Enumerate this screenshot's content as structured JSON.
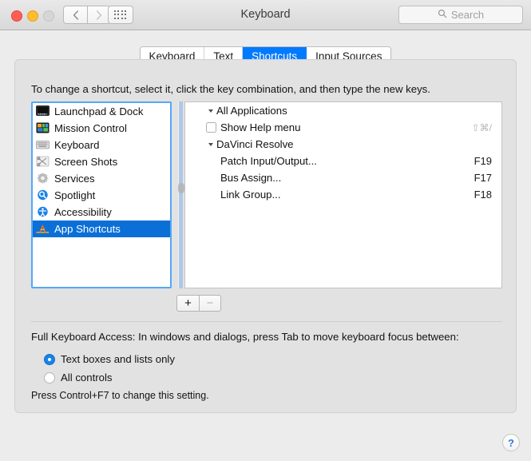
{
  "window": {
    "title": "Keyboard",
    "traffic_lights": [
      {
        "name": "close",
        "color": "#ff5f57"
      },
      {
        "name": "minimize",
        "color": "#ffbd2e"
      },
      {
        "name": "zoom",
        "color": "#d6d6d6"
      }
    ],
    "nav": {
      "back_icon": "chevron-left-icon",
      "forward_icon": "chevron-right-icon",
      "grid_icon": "show-all-grid-icon"
    },
    "search": {
      "placeholder": "Search",
      "value": "",
      "icon": "search-icon"
    }
  },
  "tabs": [
    {
      "label": "Keyboard",
      "active": false
    },
    {
      "label": "Text",
      "active": false
    },
    {
      "label": "Shortcuts",
      "active": true
    },
    {
      "label": "Input Sources",
      "active": false
    }
  ],
  "instructions": "To change a shortcut, select it, click the key combination, and then type the new keys.",
  "categories": [
    {
      "label": "Launchpad & Dock",
      "icon": "launchpad-dock-icon",
      "selected": false
    },
    {
      "label": "Mission Control",
      "icon": "mission-control-icon",
      "selected": false
    },
    {
      "label": "Keyboard",
      "icon": "keyboard-icon",
      "selected": false
    },
    {
      "label": "Screen Shots",
      "icon": "screenshots-icon",
      "selected": false
    },
    {
      "label": "Services",
      "icon": "services-gear-icon",
      "selected": false
    },
    {
      "label": "Spotlight",
      "icon": "spotlight-icon",
      "selected": false
    },
    {
      "label": "Accessibility",
      "icon": "accessibility-icon",
      "selected": false
    },
    {
      "label": "App Shortcuts",
      "icon": "app-shortcuts-icon",
      "selected": true
    }
  ],
  "shortcut_groups": [
    {
      "name": "All Applications",
      "expanded": true,
      "items": [
        {
          "label": "Show Help menu",
          "key": "⇧⌘/",
          "has_checkbox": true,
          "checked": false,
          "key_dim": true
        }
      ]
    },
    {
      "name": "DaVinci Resolve",
      "expanded": true,
      "items": [
        {
          "label": "Patch Input/Output...",
          "key": "F19",
          "has_checkbox": false,
          "checked": false,
          "key_dim": false
        },
        {
          "label": "Bus Assign...",
          "key": "F17",
          "has_checkbox": false,
          "checked": false,
          "key_dim": false
        },
        {
          "label": "Link Group...",
          "key": "F18",
          "has_checkbox": false,
          "checked": false,
          "key_dim": false
        }
      ]
    }
  ],
  "list_buttons": {
    "add_label": "+",
    "remove_label": "−"
  },
  "full_keyboard_access": {
    "label": "Full Keyboard Access: In windows and dialogs, press Tab to move keyboard focus between:",
    "options": [
      {
        "label": "Text boxes and lists only",
        "selected": true
      },
      {
        "label": "All controls",
        "selected": false
      }
    ],
    "hint": "Press Control+F7 to change this setting."
  },
  "help_button": {
    "label": "?",
    "icon": "help-question-icon"
  },
  "colors": {
    "accent_blue": "#007aff",
    "selection_blue": "#0b6fd8",
    "focus_ring": "#54a7f7",
    "panel_bg": "#e2e2e2",
    "window_bg": "#ececec"
  }
}
